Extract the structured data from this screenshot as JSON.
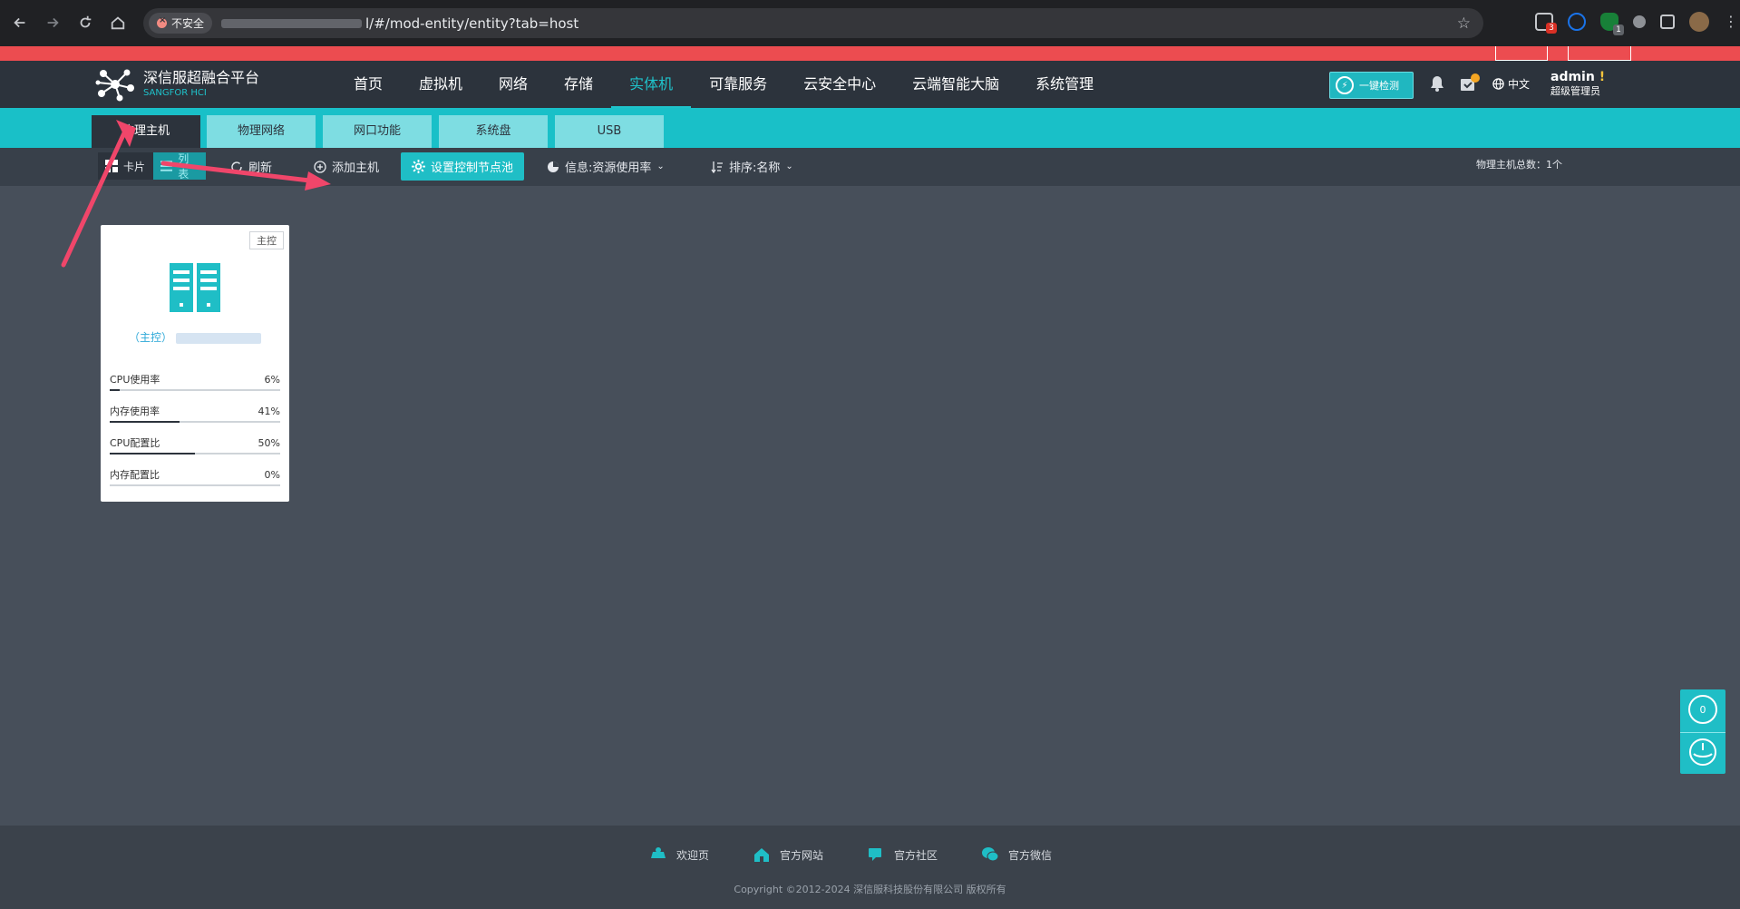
{
  "browser": {
    "insecure_label": "不安全",
    "url_tail": "l/#/mod-entity/entity?tab=host",
    "ext_badge_1": "3",
    "ext_badge_2": "1"
  },
  "header": {
    "logo_title": "深信服超融合平台",
    "logo_sub": "SANGFOR HCI",
    "nav": [
      {
        "label": "首页"
      },
      {
        "label": "虚拟机"
      },
      {
        "label": "网络"
      },
      {
        "label": "存储"
      },
      {
        "label": "实体机"
      },
      {
        "label": "可靠服务"
      },
      {
        "label": "云安全中心"
      },
      {
        "label": "云端智能大脑"
      },
      {
        "label": "系统管理"
      }
    ],
    "check_label": "一键检测",
    "lang": "中文",
    "user_name": "admin",
    "user_warn": "!",
    "user_role": "超级管理员"
  },
  "tabs": [
    {
      "label": "物理主机"
    },
    {
      "label": "物理网络"
    },
    {
      "label": "网口功能"
    },
    {
      "label": "系统盘"
    },
    {
      "label": "USB"
    }
  ],
  "toolbar": {
    "card_label": "卡片",
    "list_label": "列表",
    "refresh_label": "刷新",
    "add_host_label": "添加主机",
    "set_pool_label": "设置控制节点池",
    "info_label": "信息:资源使用率",
    "sort_label": "排序:名称",
    "host_count": "物理主机总数：1个"
  },
  "host_card": {
    "tag": "主控",
    "name_prefix": "（主控）",
    "metrics": [
      {
        "label": "CPU使用率",
        "value": "6%",
        "fraction": 0.06
      },
      {
        "label": "内存使用率",
        "value": "41%",
        "fraction": 0.41
      },
      {
        "label": "CPU配置比",
        "value": "50%",
        "fraction": 0.5
      },
      {
        "label": "内存配置比",
        "value": "0%",
        "fraction": 0.0
      }
    ]
  },
  "float_widget": {
    "count": "0"
  },
  "footer": {
    "links": [
      {
        "label": "欢迎页"
      },
      {
        "label": "官方网站"
      },
      {
        "label": "官方社区"
      },
      {
        "label": "官方微信"
      }
    ],
    "copyright": "Copyright ©2012-2024 深信服科技股份有限公司 版权所有"
  },
  "colors": {
    "accent": "#1fc3cb",
    "header_bg": "#2c333c",
    "red_strip": "#ec4c50",
    "annotation": "#f0466a"
  }
}
